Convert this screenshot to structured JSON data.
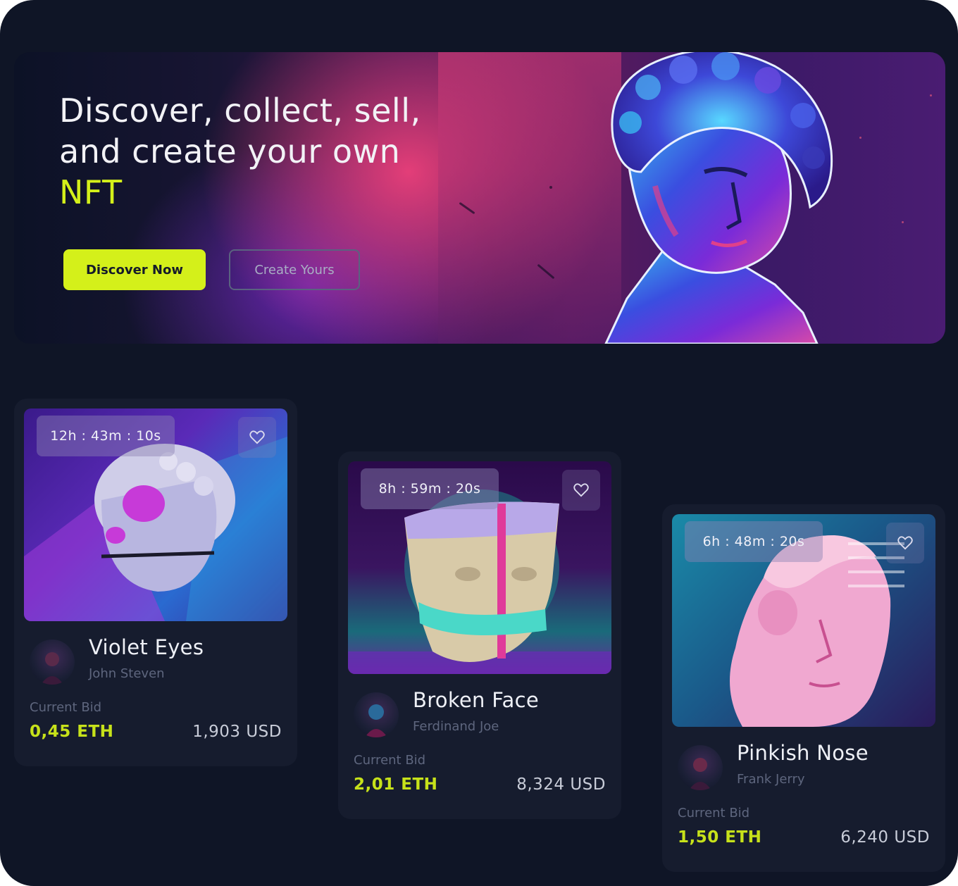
{
  "hero": {
    "title_main": "Discover, collect, sell, and create your own ",
    "title_accent": "NFT",
    "discover_button": "Discover Now",
    "create_button": "Create Yours"
  },
  "cards": [
    {
      "timer": "12h : 43m : 10s",
      "name": "Violet Eyes",
      "creator": "John Steven",
      "bid_label": "Current Bid",
      "bid_eth": "0,45 ETH",
      "bid_usd": "1,903 USD"
    },
    {
      "timer": "8h : 59m : 20s",
      "name": "Broken Face",
      "creator": "Ferdinand Joe",
      "bid_label": "Current Bid",
      "bid_eth": "2,01 ETH",
      "bid_usd": "8,324 USD"
    },
    {
      "timer": "6h : 48m : 20s",
      "name": "Pinkish Nose",
      "creator": "Frank Jerry",
      "bid_label": "Current Bid",
      "bid_eth": "1,50 ETH",
      "bid_usd": "6,240 USD"
    }
  ],
  "colors": {
    "background": "#0f1526",
    "card": "#161c2e",
    "accent": "#d4f01a",
    "text_muted": "#5e667e"
  },
  "icons": [
    "heart-icon"
  ]
}
